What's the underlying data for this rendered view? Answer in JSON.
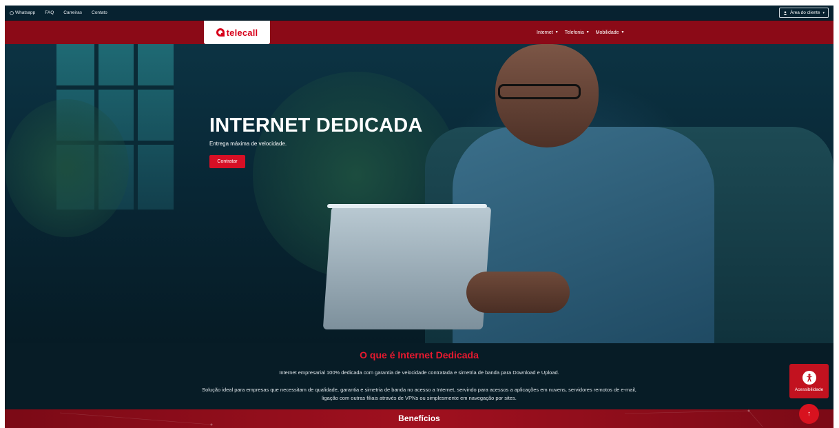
{
  "topbar": {
    "whatsapp": "Whatsapp",
    "faq": "FAQ",
    "careers": "Carreiras",
    "contact": "Contato",
    "client_area": "Área do cliente"
  },
  "brand": {
    "logo_text": "telecall",
    "color": "#d7001a"
  },
  "nav": {
    "items": [
      {
        "label": "Internet"
      },
      {
        "label": "Telefonia"
      },
      {
        "label": "Mobilidade"
      }
    ]
  },
  "hero": {
    "title": "INTERNET DEDICADA",
    "subtitle": "Entrega máxima de velocidade.",
    "cta": "Contratar"
  },
  "info": {
    "title": "O que é Internet Dedicada",
    "p1": "Internet empresarial 100% dedicada com garantia de velocidade contratada e simetria de banda para Download e Upload.",
    "p2": "Solução ideal para empresas que necessitam de qualidade, garantia e simetria de banda no acesso a Internet, servindo para acessos a aplicações em nuvens, servidores remotos de e-mail, ligação com outras filiais através de VPNs ou simplesmente em navegação por sites."
  },
  "benefits": {
    "title": "Benefícios"
  },
  "accessibility": {
    "label": "Acessibilidade"
  },
  "colors": {
    "primary_red": "#8b0a17",
    "accent_red": "#d70f25",
    "dark_bg": "#071c26"
  }
}
